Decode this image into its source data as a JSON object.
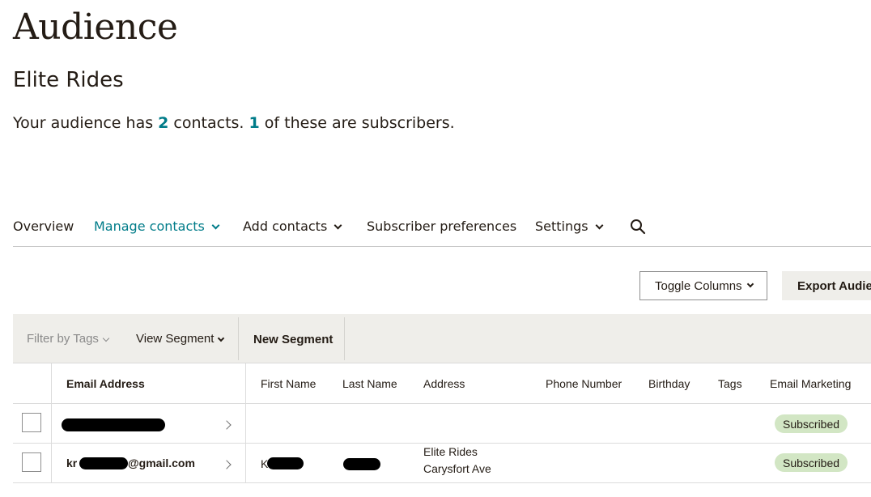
{
  "page": {
    "title": "Audience",
    "audience_name": "Elite Rides",
    "summary": {
      "prefix": "Your audience has ",
      "contacts_count": "2",
      "middle": " contacts. ",
      "subscribers_count": "1",
      "suffix": " of these are subscribers."
    }
  },
  "nav": {
    "overview": "Overview",
    "manage_contacts": "Manage contacts",
    "add_contacts": "Add contacts",
    "subscriber_preferences": "Subscriber preferences",
    "settings": "Settings",
    "search_icon": "search-icon"
  },
  "toolbar": {
    "toggle_columns": "Toggle Columns",
    "export_audience": "Export Audier"
  },
  "filterbar": {
    "filter_by_tags": "Filter by Tags",
    "view_segment": "View Segment",
    "new_segment": "New Segment"
  },
  "table": {
    "columns": [
      "Email Address",
      "First Name",
      "Last Name",
      "Address",
      "Phone Number",
      "Birthday",
      "Tags",
      "Email Marketing"
    ],
    "rows": [
      {
        "email": "",
        "first_name": "",
        "last_name": "",
        "address_line1": "",
        "address_line2": "",
        "email_marketing": "Subscribed"
      },
      {
        "email_prefix": "kr",
        "email_suffix": "@gmail.com",
        "first_name": "K",
        "last_name": "",
        "address_line1": "Elite Rides",
        "address_line2": "Carysfort Ave",
        "email_marketing": "Subscribed"
      }
    ]
  },
  "colors": {
    "accent": "#007c89",
    "subscribed_badge": "#d2e6c4",
    "filterbar_bg": "#efeeea"
  }
}
